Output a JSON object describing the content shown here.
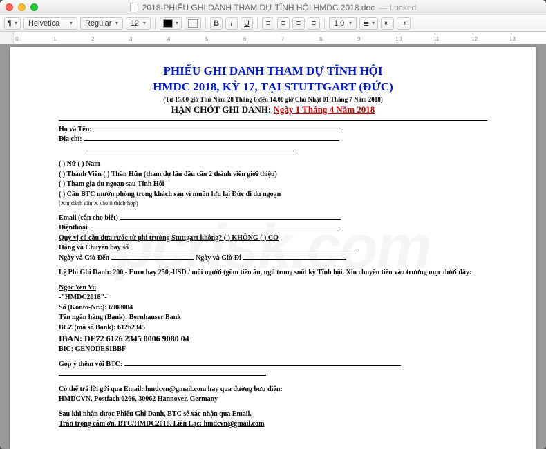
{
  "window": {
    "filename": "2018-PHIẾU GHI DANH THAM DỰ TĨNH HỘI HMDC 2018.doc",
    "locked": "— Locked"
  },
  "toolbar": {
    "font": "Helvetica",
    "weight": "Regular",
    "size": "12",
    "spacing": "1.0"
  },
  "doc": {
    "title1": "PHIẾU GHI DANH THAM DỰ TĨNH HỘI",
    "title2": "HMDC 2018, KỲ 17, TẠI STUTTGART (ĐỨC)",
    "subtitle": "(Từ 15.00 giờ Thứ Năm 28 Tháng 6 đến 14.00 giờ Chủ Nhật 01 Tháng 7 Năm 2018)",
    "deadline_label": "HẠN CHÓT GHI DANH:",
    "deadline_date": "Ngày 1 Tháng 4 Năm 2018",
    "name_label": "Họ và Tên:",
    "addr_label": "Địa chỉ:",
    "gender": "( ) Nữ    ( ) Nam",
    "member": "( ) Thành Viên    ( ) Thân Hữu (tham dự lần đầu cần 2 thành viên giới thiệu)",
    "excursion": "( ) Tham gia du ngoạn sau Tĩnh Hội",
    "room": "( ) Cần BTC mướn phòng trong khách sạn vì muốn lưu lại Đức đi du ngoạn",
    "checknote": "(Xin đánh dấu X vào ô thích hợp)",
    "email_label": "Email (cần cho biết)",
    "phone_label": "Điệnthoại",
    "pickup": "Quý vị có cần đưa rước từ phi trường Stuttgart không?   ( ) KHÔNG      ( ) CÓ",
    "airline_label": "Hãng và Chuyến bay số",
    "arrive_label": "Ngày và Giờ Đến",
    "depart_label": "Ngày và Giờ Đi",
    "fee": "Lệ Phí Ghi Danh: 200,- Euro hay 250,-USD / mỗi người (gồm tiền ăn, ngủ trong suốt kỳ Tĩnh hội. Xin chuyển tiền vào trương mục dưới đây:",
    "payee": "Ngoc Yen Vu",
    "ref": "-\"HMDC2018\"-",
    "konto_label": "Số (Konto-Nr.:): ",
    "konto": "6908004",
    "bank_label": "Tên ngân hàng (Bank): ",
    "bank": "Bernhauser Bank",
    "blz_label": "BLZ (mã số Bank): ",
    "blz": "61262345",
    "iban_label": "IBAN: ",
    "iban": "DE72 6126 2345 0006 9080 04",
    "bic_label": "BIC: ",
    "bic": "GENODES1BBF",
    "donate_label": "Góp ý thêm với BTC:",
    "reply": "Có thể trả lời gởi qua Email: hmdcvn@gmail.com   hay qua đường bưu điện:",
    "address": "HMDCVN, Postfach 6266, 30062 Hannover, Germany",
    "confirm": "Sau khi nhận được Phiếu Ghi Danh, BTC sẽ xác nhận qua Email.",
    "thanks": "Trân trọng cám ơn. BTC/HMDC2018. Liên Lạc: hmdcvn@gmail.com"
  }
}
